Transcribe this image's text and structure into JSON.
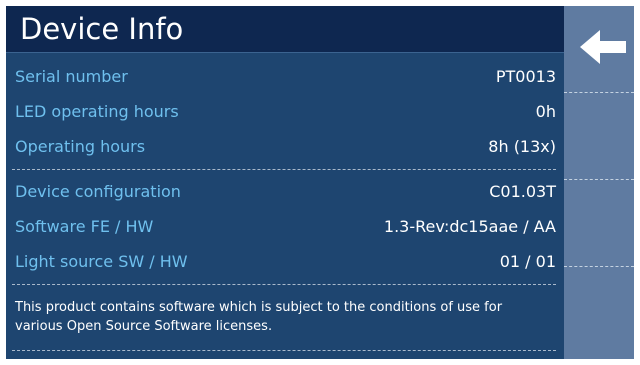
{
  "header": {
    "title": "Device Info"
  },
  "info_rows": [
    {
      "label": "Serial number",
      "value": "PT0013"
    },
    {
      "label": "LED operating hours",
      "value": "0h"
    },
    {
      "label": "Operating hours",
      "value": "8h (13x)"
    },
    {
      "label": "Device configuration",
      "value": "C01.03T"
    },
    {
      "label": "Software FE / HW",
      "value": "1.3-Rev:dc15aae / AA"
    },
    {
      "label": "Light source SW / HW",
      "value": "01 / 01"
    }
  ],
  "notice": "This product contains software which is subject to the conditions of use for various Open Source Software licenses.",
  "sidebar": {
    "back_icon": "arrow-left-icon"
  },
  "colors": {
    "background": "#1e4570",
    "title_bar": "#0e2750",
    "label": "#6fc0ee",
    "value": "#ffffff",
    "sidebar": "#5f7ba1"
  }
}
